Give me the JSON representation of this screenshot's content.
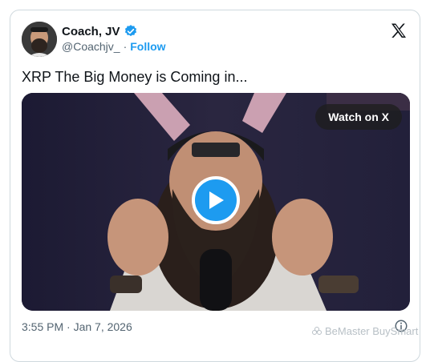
{
  "tweet": {
    "author_name": "Coach, JV",
    "handle": "@Coachjv_",
    "separator": "·",
    "follow_label": "Follow",
    "text": "XRP The Big Money is Coming in...",
    "watch_label": "Watch on X",
    "timestamp": "3:55 PM · Jan 7, 2026"
  },
  "watermark": {
    "text": "BeMaster BuySmart"
  },
  "colors": {
    "accent": "#1d9bf0",
    "text": "#0f1419",
    "muted": "#536471"
  },
  "icons": [
    "verified-badge-icon",
    "x-logo-icon",
    "play-icon",
    "info-icon",
    "watermark-flower-icon"
  ]
}
